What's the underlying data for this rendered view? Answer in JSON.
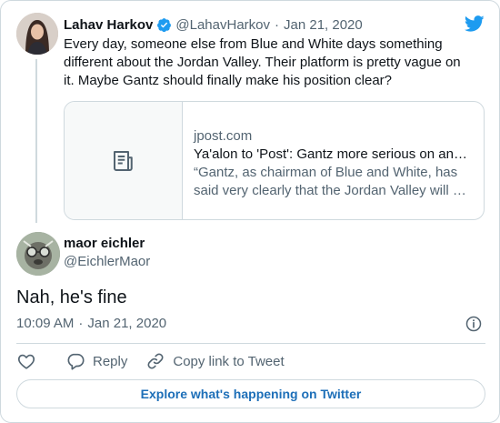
{
  "parent_tweet": {
    "author_name": "Lahav Harkov",
    "handle": "@LahavHarkov",
    "separator": "·",
    "date": "Jan 21, 2020",
    "text": "Every day, someone else from Blue and White days something different about the Jordan Valley. Their platform is pretty vague on it. Maybe Gantz should finally make his position clear?",
    "link_card": {
      "domain": "jpost.com",
      "title": "Ya'alon to 'Post': Gantz more serious on annexation",
      "description": "“Gantz, as chairman of Blue and White, has said very clearly that the Jordan Valley will be under Israeli sovereignty"
    }
  },
  "main_tweet": {
    "author_name": "maor eichler",
    "handle": "@EichlerMaor",
    "text": "Nah, he's fine",
    "time": "10:09 AM",
    "separator": "·",
    "date": "Jan 21, 2020"
  },
  "actions": {
    "reply_label": "Reply",
    "copy_link_label": "Copy link to Tweet"
  },
  "explore_label": "Explore what's happening on Twitter",
  "colors": {
    "brand_blue": "#1d9bf0",
    "link_blue": "#1d6fb8",
    "text": "#0f1419",
    "muted": "#536471",
    "border": "#cfd9de"
  },
  "icons": {
    "logo": "twitter-bird-icon",
    "verified": "verified-badge-icon",
    "link_thumb": "article-icon",
    "info": "info-icon",
    "like": "heart-icon",
    "reply": "reply-bubble-icon",
    "copy_link": "link-chain-icon"
  }
}
